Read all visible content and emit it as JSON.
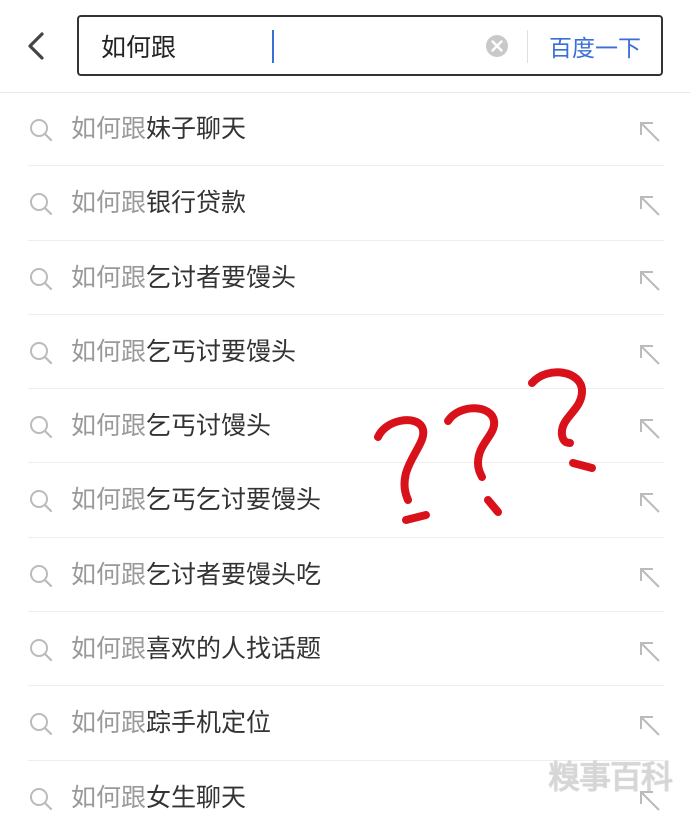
{
  "search": {
    "value": "如何跟",
    "submit_label": "百度一下"
  },
  "icons": {
    "back": "chevron-left-icon",
    "clear": "clear-circle-icon",
    "suggestion": "search-icon",
    "fill": "arrow-up-left-icon"
  },
  "colors": {
    "accent": "#3a6fd8",
    "query_text": "#999999",
    "suggestion_text": "#333333",
    "annotation": "#d8111b"
  },
  "suggestions": [
    {
      "query": "如何跟",
      "rest": "妹子聊天"
    },
    {
      "query": "如何跟",
      "rest": "银行贷款"
    },
    {
      "query": "如何跟",
      "rest": "乞讨者要馒头"
    },
    {
      "query": "如何跟",
      "rest": "乞丐讨要馒头"
    },
    {
      "query": "如何跟",
      "rest": "乞丐讨馒头"
    },
    {
      "query": "如何跟",
      "rest": "乞丐乞讨要馒头"
    },
    {
      "query": "如何跟",
      "rest": "乞讨者要馒头吃"
    },
    {
      "query": "如何跟",
      "rest": "喜欢的人找话题"
    },
    {
      "query": "如何跟",
      "rest": "踪手机定位"
    },
    {
      "query": "如何跟",
      "rest": "女生聊天"
    }
  ],
  "annotation": {
    "marks": "???"
  },
  "watermark": {
    "text": "糗事百科"
  }
}
